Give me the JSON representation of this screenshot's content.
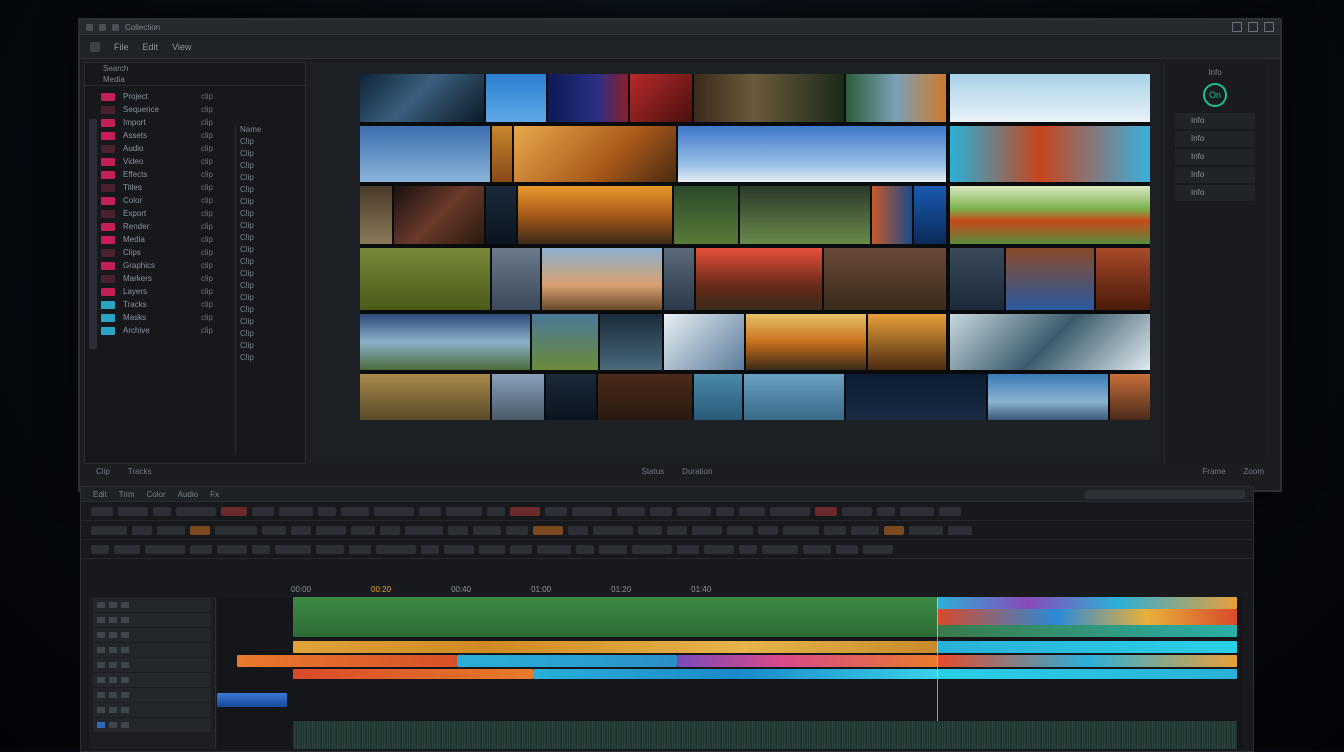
{
  "monitor": {
    "title": "Collection",
    "menu": [
      "File",
      "Edit",
      "View"
    ],
    "left_panel": {
      "header_lines": [
        "Search",
        "Media"
      ],
      "rows": [
        {
          "label": "Project",
          "value": "clip"
        },
        {
          "label": "Sequence",
          "value": "clip"
        },
        {
          "label": "Import",
          "value": "clip"
        },
        {
          "label": "Assets",
          "value": "clip"
        },
        {
          "label": "Audio",
          "value": "clip"
        },
        {
          "label": "Video",
          "value": "clip"
        },
        {
          "label": "Effects",
          "value": "clip"
        },
        {
          "label": "Titles",
          "value": "clip"
        },
        {
          "label": "Color",
          "value": "clip"
        },
        {
          "label": "Export",
          "value": "clip"
        },
        {
          "label": "Render",
          "value": "clip"
        },
        {
          "label": "Media",
          "value": "clip"
        },
        {
          "label": "Clips",
          "value": "clip"
        },
        {
          "label": "Graphics",
          "value": "clip"
        },
        {
          "label": "Markers",
          "value": "clip"
        },
        {
          "label": "Layers",
          "value": "clip"
        },
        {
          "label": "Tracks",
          "value": "clip"
        },
        {
          "label": "Masks",
          "value": "clip"
        },
        {
          "label": "Archive",
          "value": "clip"
        }
      ],
      "mid_list": [
        "Name",
        "Clip",
        "Clip",
        "Clip",
        "Clip",
        "Clip",
        "Clip",
        "Clip",
        "Clip",
        "Clip",
        "Clip",
        "Clip",
        "Clip",
        "Clip",
        "Clip",
        "Clip",
        "Clip",
        "Clip",
        "Clip",
        "Clip"
      ]
    },
    "right_panel": {
      "title": "Info",
      "circle_label": "On",
      "items": [
        "Info",
        "Info",
        "Info",
        "Info",
        "Info"
      ]
    },
    "status": [
      "Clip",
      "Tracks",
      "Status",
      "Duration",
      "Frame",
      "Zoom"
    ]
  },
  "editor": {
    "tabs": [
      "Edit",
      "Trim",
      "Color",
      "Audio",
      "Fx"
    ],
    "ruler": [
      "00:00",
      "00:20",
      "00:40",
      "01:00",
      "01:20",
      "01:40"
    ],
    "highlight_label": "00:20"
  }
}
